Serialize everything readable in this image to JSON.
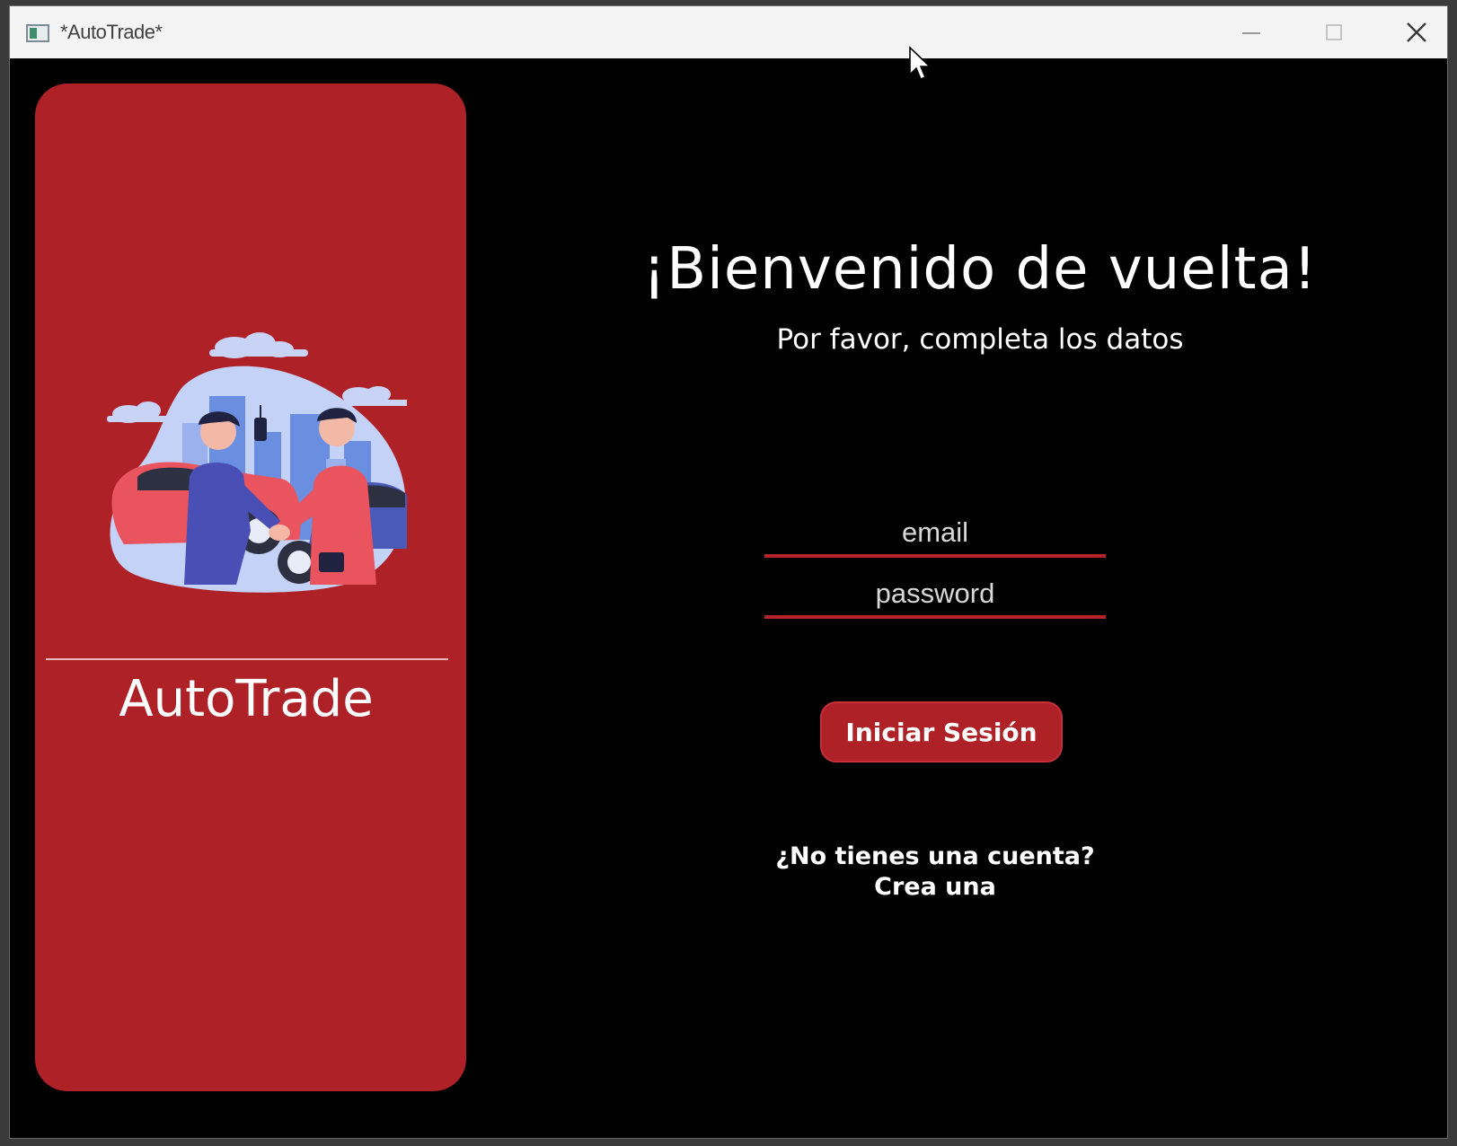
{
  "window": {
    "title": "*AutoTrade*",
    "icons": {
      "app": "app-window-icon",
      "minimize": "minimize-icon",
      "maximize": "maximize-icon",
      "close": "close-icon"
    }
  },
  "sidebar": {
    "brand": "AutoTrade",
    "illustration": "car-deal-handshake-illustration"
  },
  "login": {
    "title": "¡Bienvenido de vuelta!",
    "subtitle": "Por favor, completa los datos",
    "email_placeholder": "email",
    "email_value": "",
    "password_placeholder": "password",
    "password_value": "",
    "submit_label": "Iniciar Sesión",
    "signup_prompt": "¿No tienes una cuenta?",
    "signup_link": "Crea una"
  },
  "colors": {
    "accent": "#ae2127",
    "background": "#000000",
    "text": "#ffffff"
  }
}
